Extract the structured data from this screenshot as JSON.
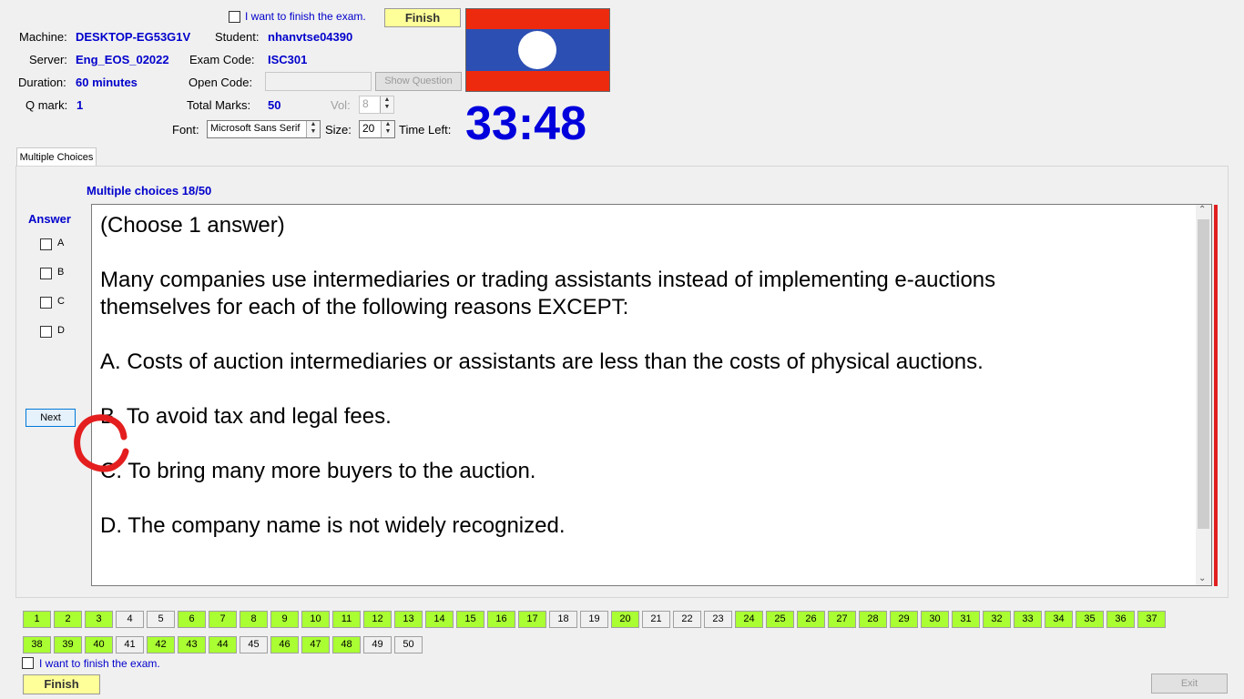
{
  "header": {
    "finish_checkbox_label": "I want to finish the exam.",
    "finish_label": "Finish",
    "machine_label": "Machine:",
    "machine_value": "DESKTOP-EG53G1V",
    "student_label": "Student:",
    "student_value": "nhanvtse04390",
    "server_label": "Server:",
    "server_value": "Eng_EOS_02022",
    "exam_code_label": "Exam Code:",
    "exam_code_value": "ISC301",
    "duration_label": "Duration:",
    "duration_value": "60 minutes",
    "open_code_label": "Open Code:",
    "show_question_label": "Show Question",
    "qmark_label": "Q mark:",
    "qmark_value": "1",
    "total_marks_label": "Total Marks:",
    "total_marks_value": "50",
    "vol_label": "Vol:",
    "vol_value": "8",
    "font_label": "Font:",
    "font_value": "Microsoft Sans Serif",
    "size_label": "Size:",
    "size_value": "20",
    "time_left_label": "Time Left:",
    "timer": "33:48"
  },
  "flag": {
    "colors": {
      "band": "#ee2a0e",
      "middle": "#2c4fb3",
      "circle": "#ffffff"
    }
  },
  "tab": {
    "label": "Multiple Choices"
  },
  "main": {
    "progress": "Multiple choices 18/50",
    "answer_label": "Answer",
    "options": [
      "A",
      "B",
      "C",
      "D"
    ],
    "next_label": "Next",
    "question": {
      "instruction": "(Choose 1 answer)",
      "stem": "Many companies use intermediaries or trading assistants instead of implementing e-auctions themselves for each of the following reasons EXCEPT:",
      "choices": [
        "A.  Costs of auction intermediaries or assistants are less than the costs of physical auctions.",
        "B.  To avoid tax and legal fees.",
        "C.  To bring many more buyers to the auction.",
        "D.  The company name is not widely recognized."
      ]
    }
  },
  "footer": {
    "finish_checkbox_label": "I want to finish the exam.",
    "finish_label": "Finish",
    "exit_label": "Exit"
  },
  "questions": {
    "numbers": [
      "1",
      "2",
      "3",
      "4",
      "5",
      "6",
      "7",
      "8",
      "9",
      "10",
      "11",
      "12",
      "13",
      "14",
      "15",
      "16",
      "17",
      "18",
      "19",
      "20",
      "21",
      "22",
      "23",
      "24",
      "25",
      "26",
      "27",
      "28",
      "29",
      "30",
      "31",
      "32",
      "33",
      "34",
      "35",
      "36",
      "37",
      "38",
      "39",
      "40",
      "41",
      "42",
      "43",
      "44",
      "45",
      "46",
      "47",
      "48",
      "49",
      "50"
    ],
    "answered": [
      1,
      2,
      3,
      6,
      7,
      8,
      9,
      10,
      11,
      12,
      13,
      14,
      15,
      16,
      17,
      20,
      24,
      25,
      26,
      27,
      28,
      29,
      30,
      31,
      32,
      33,
      34,
      35,
      36,
      37,
      38,
      39,
      40,
      42,
      43,
      44,
      46,
      47,
      48
    ],
    "colors": {
      "answered": "#aaff33",
      "unanswered": "#f0f0f0"
    }
  }
}
